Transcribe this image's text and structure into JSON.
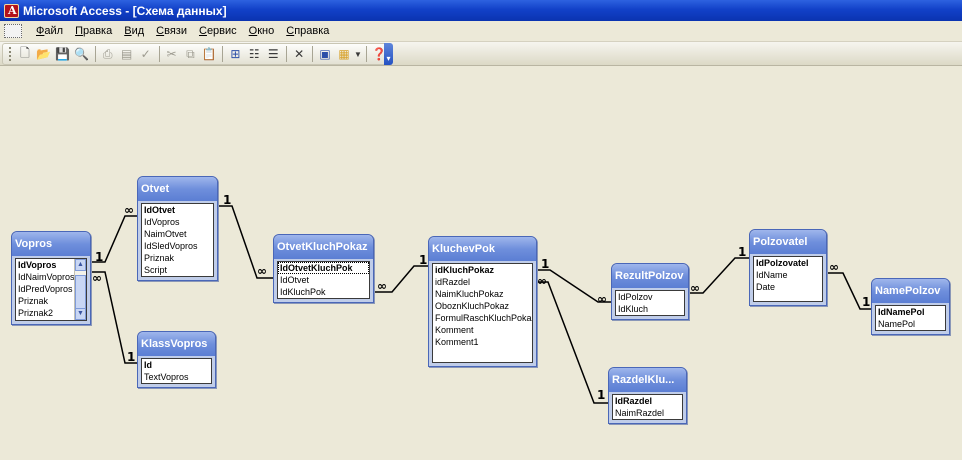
{
  "window": {
    "title": "Microsoft Access - [Схема данных]"
  },
  "menu": [
    "Файл",
    "Правка",
    "Вид",
    "Связи",
    "Сервис",
    "Окно",
    "Справка"
  ],
  "toolbar_icons": [
    "new-icon",
    "open-icon",
    "save-icon",
    "print-preview-icon",
    "print-icon",
    "spell-icon",
    "cut-icon",
    "copy-icon",
    "paste-icon",
    "show-table-icon",
    "show-direct-icon",
    "show-all-icon",
    "delete-icon",
    "office-links-icon",
    "new-object-icon",
    "help-icon"
  ],
  "tables": {
    "vopros": {
      "name": "Vopros",
      "fields": [
        "IdVopros",
        "IdNaimVopros",
        "IdPredVopros",
        "Priznak",
        "Priznak2"
      ]
    },
    "otvet": {
      "name": "Otvet",
      "fields": [
        "IdOtvet",
        "IdVopros",
        "NaimOtvet",
        "IdSledVopros",
        "Priznak",
        "Script"
      ]
    },
    "klassvopros": {
      "name": "KlassVopros",
      "fields": [
        "Id",
        "TextVopros"
      ]
    },
    "otvetkluchpokaz": {
      "name": "OtvetKluchPokaz",
      "fields": [
        "IdOtvetKluchPok",
        "IdOtvet",
        "IdKluchPok"
      ]
    },
    "kluchevpok": {
      "name": "KluchevPok",
      "fields": [
        "idKluchPokaz",
        "idRazdel",
        "NaimKluchPokaz",
        "OboznKluchPokaz",
        "FormulRaschKluchPokaz",
        "Komment",
        "Komment1"
      ]
    },
    "rezultpolzov": {
      "name": "RezultPolzov",
      "fields": [
        "IdPolzov",
        "IdKluch"
      ]
    },
    "razdelkluch": {
      "name": "RazdelKlu...",
      "fields": [
        "IdRazdel",
        "NaimRazdel"
      ]
    },
    "polzovatel": {
      "name": "Polzovatel",
      "fields": [
        "IdPolzovatel",
        "IdName",
        "Date"
      ]
    },
    "namepolzov": {
      "name": "NamePolzov",
      "fields": [
        "IdNamePol",
        "NamePol"
      ]
    }
  },
  "relations": [
    {
      "from": "vopros",
      "to": "otvet",
      "from_card": "1",
      "to_card": "∞"
    },
    {
      "from": "vopros",
      "to": "klassvopros",
      "from_card": "∞",
      "to_card": "1"
    },
    {
      "from": "otvet",
      "to": "otvetkluchpokaz",
      "from_card": "1",
      "to_card": "∞"
    },
    {
      "from": "otvetkluchpokaz",
      "to": "kluchevpok",
      "from_card": "∞",
      "to_card": "1"
    },
    {
      "from": "kluchevpok",
      "to": "rezultpolzov",
      "from_card": "1",
      "to_card": "∞"
    },
    {
      "from": "kluchevpok",
      "to": "razdelkluch",
      "from_card": "∞",
      "to_card": "1"
    },
    {
      "from": "rezultpolzov",
      "to": "polzovatel",
      "from_card": "∞",
      "to_card": "1"
    },
    {
      "from": "polzovatel",
      "to": "namepolzov",
      "from_card": "∞",
      "to_card": "1"
    }
  ]
}
